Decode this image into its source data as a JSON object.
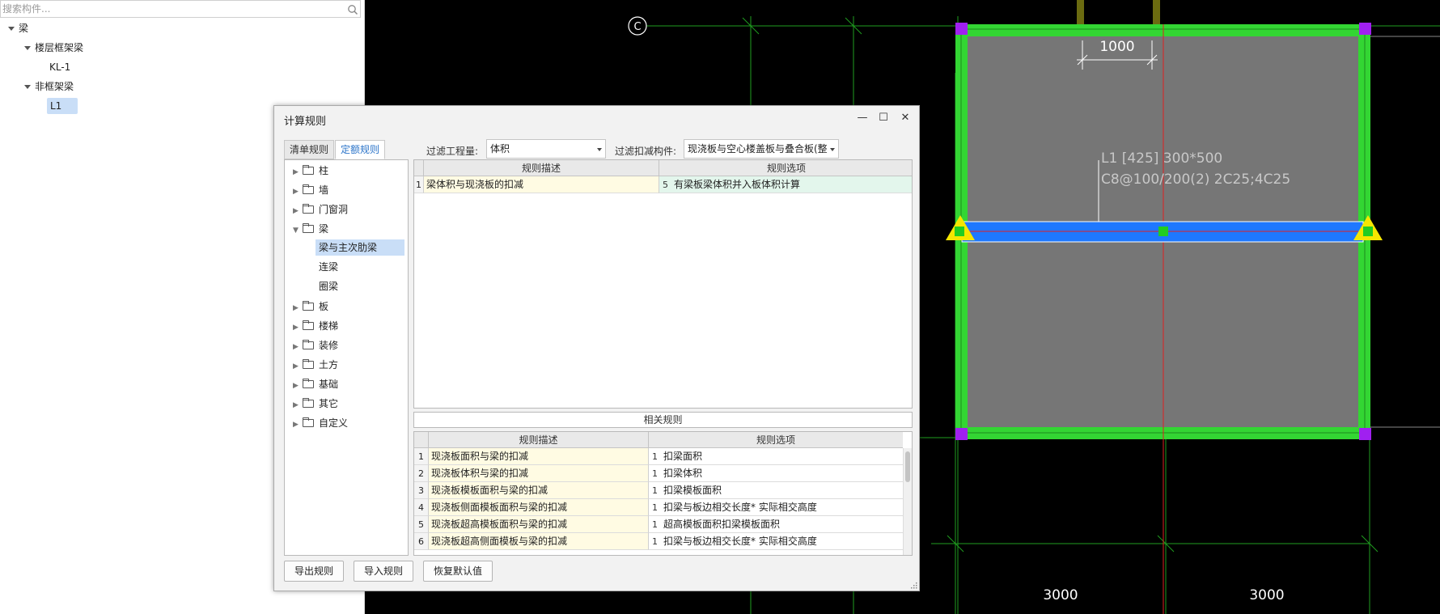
{
  "search": {
    "placeholder": "搜索构件..."
  },
  "component_tree": {
    "root": "梁",
    "group1": "楼层框架梁",
    "group1_item": "KL-1",
    "group2": "非框架梁",
    "group2_item": "L1"
  },
  "cad": {
    "axis_label": "C",
    "dimension_top": "1000",
    "beam_label_line1": "L1 [425] 300*500",
    "beam_label_line2": "C8@100/200(2) 2C25;4C25",
    "dimension_bottom_left": "3000",
    "dimension_bottom_right": "3000"
  },
  "dialog": {
    "title": "计算规则",
    "minimize": "—",
    "maximize": "☐",
    "close": "✕",
    "tabs": [
      "清单规则",
      "定额规则"
    ],
    "filter_quantity_label": "过滤工程量:",
    "filter_quantity_value": "体积",
    "filter_deduct_label": "过滤扣减构件:",
    "filter_deduct_value": "现浇板与空心楼盖板与叠合板(整",
    "rule_tree": {
      "items": [
        "柱",
        "墙",
        "门窗洞",
        "梁",
        "板",
        "楼梯",
        "装修",
        "土方",
        "基础",
        "其它",
        "自定义"
      ],
      "beam_children": [
        "梁与主次肋梁",
        "连梁",
        "圈梁"
      ]
    },
    "main_grid": {
      "headers": [
        "规则描述",
        "规则选项"
      ],
      "rows": [
        {
          "no": "1",
          "desc": "梁体积与现浇板的扣减",
          "opt_no": "5",
          "opt": "有梁板梁体积并入板体积计算"
        }
      ]
    },
    "related_title": "相关规则",
    "related_grid": {
      "headers": [
        "规则描述",
        "规则选项"
      ],
      "rows": [
        {
          "no": "1",
          "desc": "现浇板面积与梁的扣减",
          "opt_no": "1",
          "opt": "扣梁面积"
        },
        {
          "no": "2",
          "desc": "现浇板体积与梁的扣减",
          "opt_no": "1",
          "opt": "扣梁体积"
        },
        {
          "no": "3",
          "desc": "现浇板模板面积与梁的扣减",
          "opt_no": "1",
          "opt": "扣梁模板面积"
        },
        {
          "no": "4",
          "desc": "现浇板侧面模板面积与梁的扣减",
          "opt_no": "1",
          "opt": "扣梁与板边相交长度* 实际相交高度"
        },
        {
          "no": "5",
          "desc": "现浇板超高模板面积与梁的扣减",
          "opt_no": "1",
          "opt": "超高模板面积扣梁模板面积"
        },
        {
          "no": "6",
          "desc": "现浇板超高侧面模板与梁的扣减",
          "opt_no": "1",
          "opt": "扣梁与板边相交长度* 实际相交高度"
        }
      ]
    },
    "buttons": {
      "export": "导出规则",
      "import": "导入规则",
      "restore": "恢复默认值"
    }
  },
  "colors": {
    "accent": "#2b74c9",
    "beam_green": "#33d633",
    "selected_beam": "#1e78ff"
  }
}
